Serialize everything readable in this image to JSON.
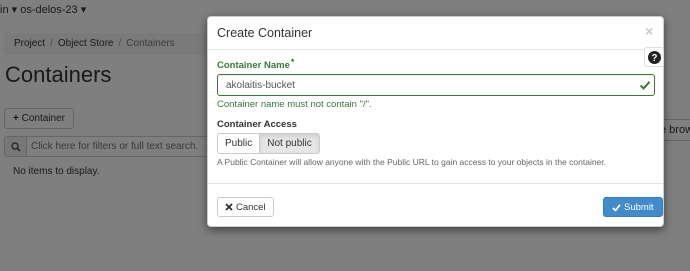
{
  "topbar": {
    "project_label": "in ▾ os-delos-23 ▾"
  },
  "breadcrumb": {
    "project": "Project",
    "object_store": "Object Store",
    "containers": "Containers",
    "separator": "/"
  },
  "page": {
    "title": "Containers",
    "add_button_label": "Container",
    "filter_placeholder": "Click here for filters or full text search.",
    "empty_message": "No items to display.",
    "browse_label": "e brow"
  },
  "modal": {
    "title": "Create Container",
    "close_glyph": "×",
    "name_label": "Container Name",
    "required_mark": "*",
    "name_value": "akolaitis-bucket",
    "name_help": "Container name must not contain \"/\".",
    "access_label": "Container Access",
    "access_options": [
      "Public",
      "Not public"
    ],
    "access_selected": "Not public",
    "access_description": "A Public Container will allow anyone with the Public URL to gain access to your objects in the container.",
    "cancel_label": "Cancel",
    "submit_label": "Submit"
  },
  "icons": {
    "close": "close-icon",
    "help": "question-circle-icon",
    "valid": "check-icon",
    "search": "search-icon",
    "plus": "plus-icon"
  },
  "colors": {
    "success": "#3c763d",
    "primary": "#428bca",
    "overlay": "rgba(0,0,0,0.5)"
  }
}
